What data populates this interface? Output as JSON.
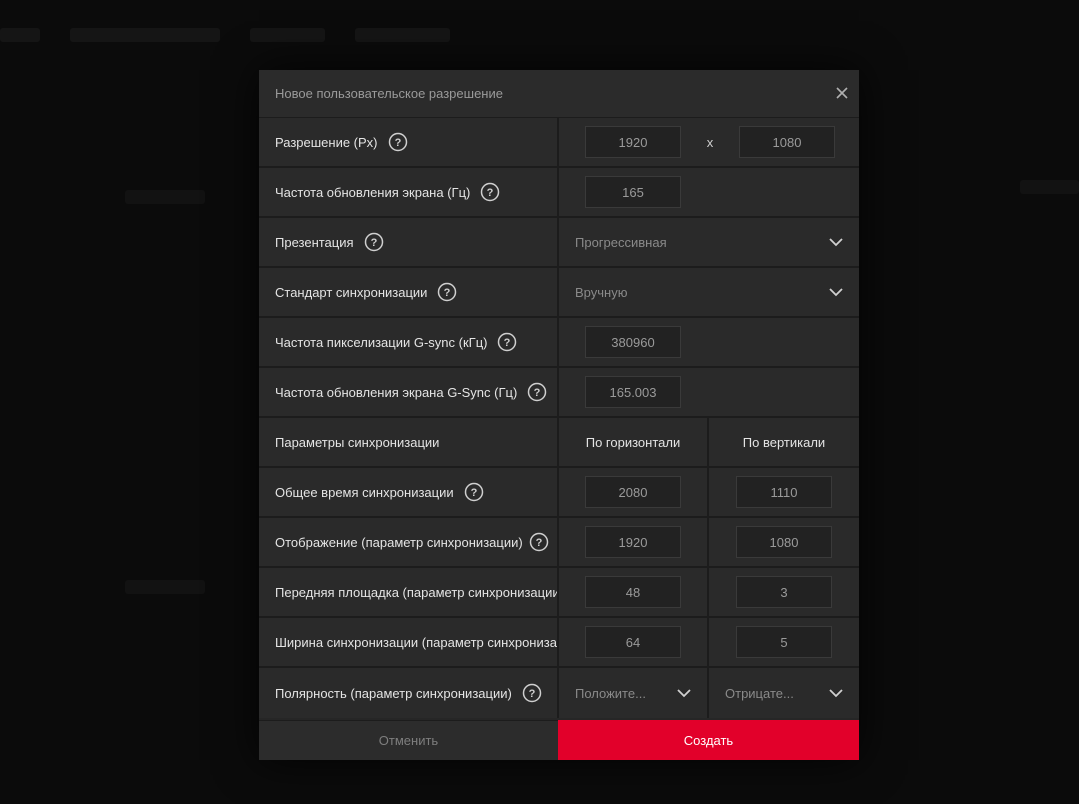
{
  "dialog": {
    "title": "Новое пользовательское разрешение",
    "close_icon": "close-icon"
  },
  "resolution": {
    "label": "Разрешение (Px)",
    "width": "1920",
    "separator": "x",
    "height": "1080"
  },
  "refresh_rate": {
    "label": "Частота обновления экрана (Гц)",
    "value": "165"
  },
  "presentation": {
    "label": "Презентация",
    "selected": "Прогрессивная"
  },
  "timing_standard": {
    "label": "Стандарт синхронизации",
    "selected": "Вручную"
  },
  "gsync_pixel_clock": {
    "label": "Частота пикселизации G-sync (кГц)",
    "value": "380960"
  },
  "gsync_refresh_rate": {
    "label": "Частота обновления экрана G-Sync (Гц)",
    "value": "165.003"
  },
  "timing_params": {
    "label": "Параметры синхронизации",
    "horizontal_header": "По горизонтали",
    "vertical_header": "По вертикали"
  },
  "total": {
    "label": "Общее время синхронизации",
    "horizontal": "2080",
    "vertical": "1110"
  },
  "active": {
    "label": "Отображение (параметр синхронизации)",
    "horizontal": "1920",
    "vertical": "1080"
  },
  "front_porch": {
    "label": "Передняя площадка (параметр синхронизации)",
    "horizontal": "48",
    "vertical": "3"
  },
  "sync_width": {
    "label": "Ширина синхронизации (параметр синхронизации)",
    "horizontal": "64",
    "vertical": "5"
  },
  "polarity": {
    "label": "Полярность (параметр синхронизации)",
    "horizontal": "Положите...",
    "vertical": "Отрицате..."
  },
  "buttons": {
    "cancel": "Отменить",
    "create": "Создать"
  },
  "colors": {
    "accent": "#e2002a",
    "dialog_bg": "#2a2a2a",
    "page_bg": "#0b0b0b"
  }
}
